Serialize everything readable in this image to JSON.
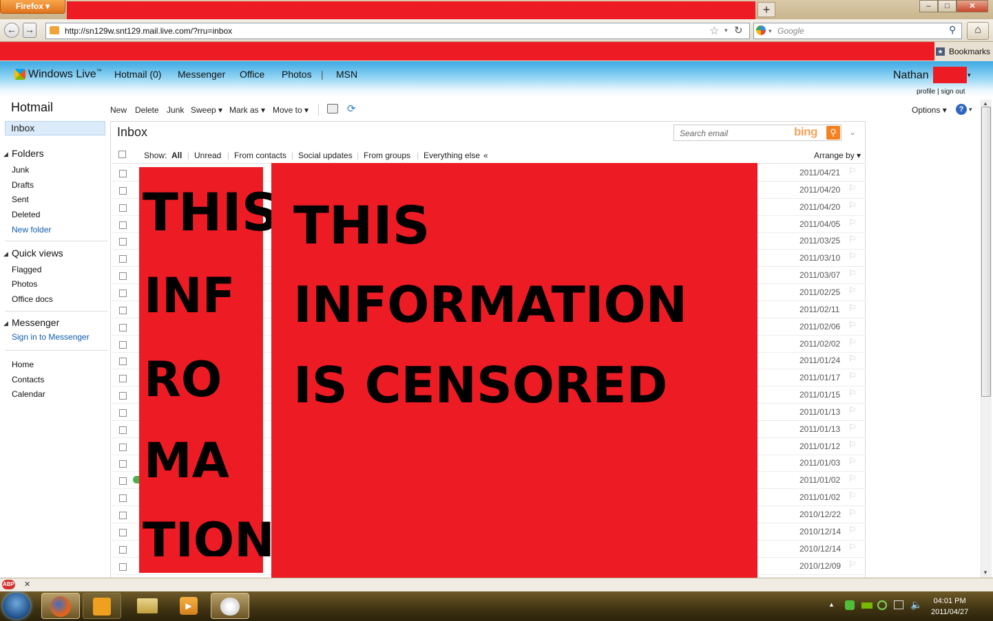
{
  "browser": {
    "app_button": "Firefox",
    "new_tab": "+",
    "url": "http://sn129w.snt129.mail.live.com/?rru=inbox",
    "search_placeholder": "Google",
    "bookmarks_label": "Bookmarks",
    "win_min": "–",
    "win_max": "□",
    "win_close": "✕",
    "censor_color": "#ed1c24"
  },
  "header": {
    "logo": "Windows Live",
    "tm": "™",
    "nav": [
      "Hotmail (0)",
      "Messenger",
      "Office",
      "Photos",
      "|",
      "MSN"
    ],
    "user_name": "Nathan",
    "profile_links": "profile | sign out"
  },
  "sidebar": {
    "title": "Hotmail",
    "inbox": "Inbox",
    "folders_header": "Folders",
    "folders": [
      "Junk",
      "Drafts",
      "Sent",
      "Deleted"
    ],
    "new_folder": "New folder",
    "quickviews_header": "Quick views",
    "quickviews": [
      "Flagged",
      "Photos",
      "Office docs"
    ],
    "messenger_header": "Messenger",
    "messenger_signin": "Sign in to Messenger",
    "bottom_links": [
      "Home",
      "Contacts",
      "Calendar"
    ]
  },
  "toolbar": {
    "new": "New",
    "delete": "Delete",
    "junk": "Junk",
    "sweep": "Sweep ▾",
    "mark_as": "Mark as ▾",
    "move_to": "Move to ▾",
    "options": "Options ▾",
    "help": "?",
    "help_caret": "▾"
  },
  "inbox": {
    "title": "Inbox",
    "search_placeholder": "Search email",
    "bing": "bing",
    "show_label": "Show:",
    "filters": [
      "All",
      "Unread",
      "From contacts",
      "Social updates",
      "From groups",
      "Everything else"
    ],
    "collapse": "«",
    "arrange_by": "Arrange by ▾",
    "dates": [
      "2011/04/21",
      "2011/04/20",
      "2011/04/20",
      "2011/04/05",
      "2011/03/25",
      "2011/03/10",
      "2011/03/07",
      "2011/02/25",
      "2011/02/11",
      "2011/02/06",
      "2011/02/02",
      "2011/01/24",
      "2011/01/17",
      "2011/01/15",
      "2011/01/13",
      "2011/01/13",
      "2011/01/12",
      "2011/01/03",
      "2011/01/02",
      "2011/01/02",
      "2010/12/22",
      "2010/12/14",
      "2010/12/14",
      "2010/12/09"
    ]
  },
  "censor": {
    "left_lines": [
      "THIS",
      "INF",
      "RO",
      "MA",
      "TION"
    ],
    "right_lines": [
      "THIS",
      "INFORMATION",
      "IS CENSORED"
    ]
  },
  "taskbar": {
    "time": "04:01 PM",
    "date": "2011/04/27"
  }
}
